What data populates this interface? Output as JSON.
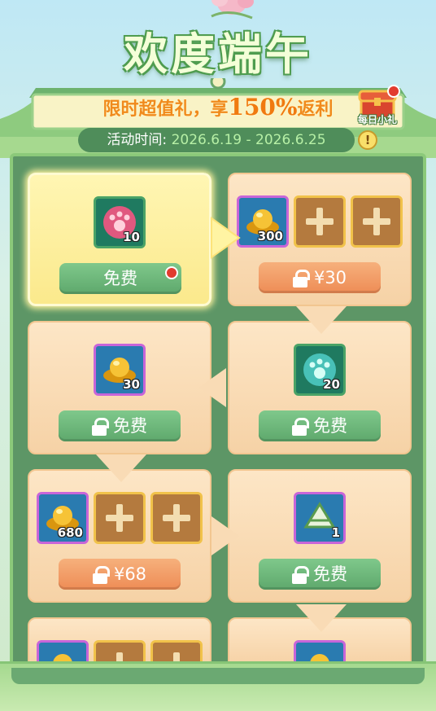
{
  "header": {
    "title": "欢度端午",
    "subtitle_prefix": "限时超值礼，享",
    "subtitle_percent": "150%",
    "subtitle_suffix": "返利",
    "daily_gift_label": "每日小礼",
    "time_label": "活动时间:",
    "time_range": "2026.6.19 - 2026.6.25",
    "info_icon": "!"
  },
  "cells": [
    {
      "items": [
        {
          "type": "paw-pink",
          "qty": "10"
        }
      ],
      "button": "免费",
      "locked": false,
      "price": false
    },
    {
      "items": [
        {
          "type": "gold-ingot",
          "qty": "300"
        },
        {
          "type": "plus"
        },
        {
          "type": "plus"
        }
      ],
      "button": "¥30",
      "locked": true,
      "price": true
    },
    {
      "items": [
        {
          "type": "gold-ingot",
          "qty": "30"
        }
      ],
      "button": "免费",
      "locked": true,
      "price": false
    },
    {
      "items": [
        {
          "type": "paw-blue",
          "qty": "20"
        }
      ],
      "button": "免费",
      "locked": true,
      "price": false
    },
    {
      "items": [
        {
          "type": "gold-ingot",
          "qty": "680"
        },
        {
          "type": "plus"
        },
        {
          "type": "plus"
        }
      ],
      "button": "¥68",
      "locked": true,
      "price": true
    },
    {
      "items": [
        {
          "type": "zongzi",
          "qty": "1"
        }
      ],
      "button": "免费",
      "locked": true,
      "price": false
    }
  ],
  "colors": {
    "accent_green": "#5ea86c",
    "price_orange": "#ee8c55",
    "panel_cream": "#fde6c6"
  }
}
